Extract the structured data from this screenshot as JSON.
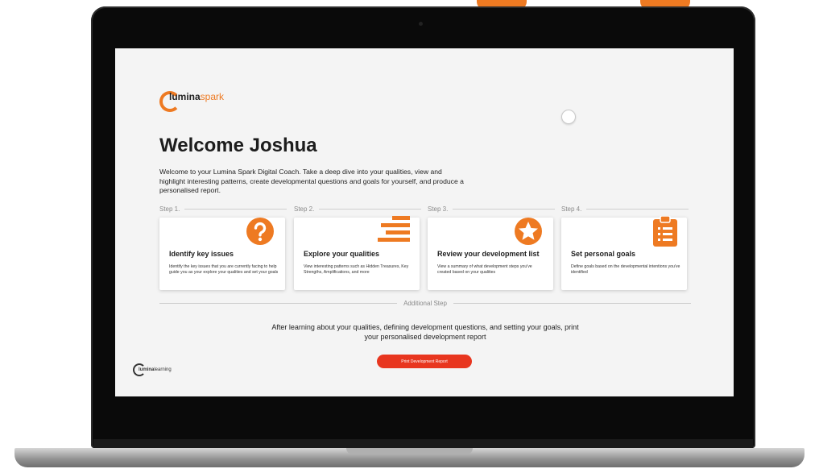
{
  "header": {
    "logo_primary": "lumina",
    "logo_secondary": "spark"
  },
  "main": {
    "title": "Welcome Joshua",
    "intro": "Welcome to your Lumina Spark Digital Coach. Take a deep dive into your qualities, view and highlight interesting patterns, create developmental questions and goals for yourself, and produce a personalised report.",
    "steps": [
      {
        "step_label": "Step 1.",
        "title": "Identify key issues",
        "description": "Identify the key issues that you are currently facing to help guide you as your explore your qualities and set your goals",
        "icon": "question-icon"
      },
      {
        "step_label": "Step 2.",
        "title": "Explore your qualities",
        "description": "View interesting patterns such as Hidden Treasures, Key Strengths, Amplifications, and more",
        "icon": "stacked-bars-icon"
      },
      {
        "step_label": "Step 3.",
        "title": "Review your development list",
        "description": "View a summary of what development steps you've created based on your qualities",
        "icon": "star-icon"
      },
      {
        "step_label": "Step 4.",
        "title": "Set personal goals",
        "description": "Define goals based on the developmental intentions you've identified",
        "icon": "clipboard-icon"
      }
    ],
    "additional_step_label": "Additional Step",
    "after_text": "After learning about your qualities, defining development questions, and setting your goals, print your personalised development report",
    "print_button_label": "Print Development Report"
  },
  "footer": {
    "logo_primary": "lumina",
    "logo_secondary": "learning"
  },
  "colors": {
    "accent": "#ee7a22",
    "button": "#e8361f",
    "screen_bg": "#f4f4f4"
  }
}
